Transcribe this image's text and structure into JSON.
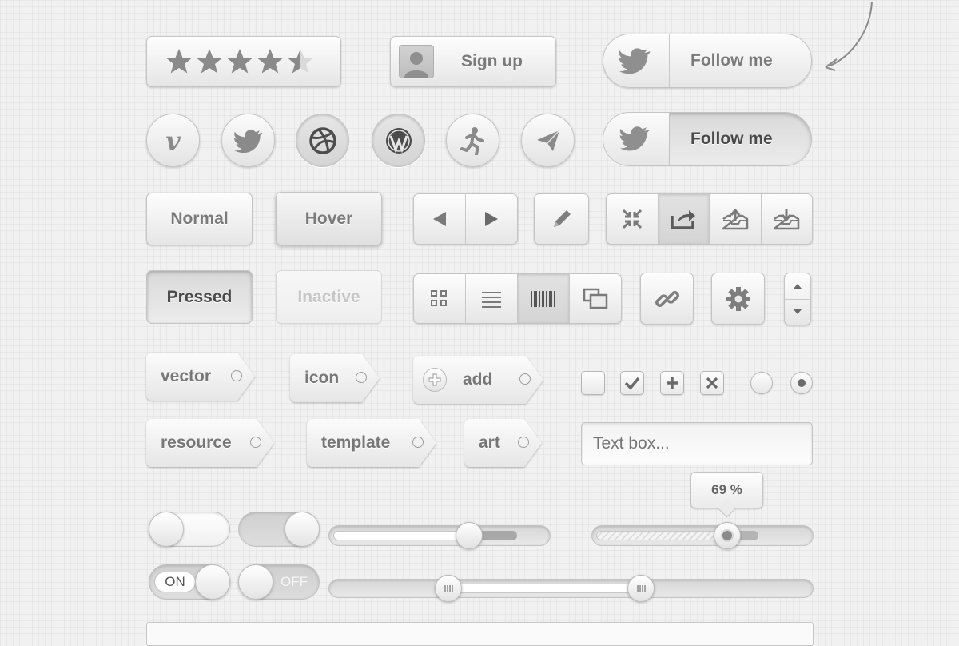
{
  "buttons": {
    "signup_label": "Sign up",
    "follow_label": "Follow me",
    "follow_pressed_label": "Follow me",
    "normal_label": "Normal",
    "hover_label": "Hover",
    "pressed_label": "Pressed",
    "inactive_label": "Inactive"
  },
  "rating": {
    "value": 4.5,
    "max": 5
  },
  "social_icons": [
    "vimeo-icon",
    "twitter-icon",
    "dribbble-icon",
    "wordpress-icon",
    "runner-icon",
    "paper-plane-icon"
  ],
  "tags": {
    "row1": [
      "vector",
      "icon",
      "add"
    ],
    "row2": [
      "resource",
      "template",
      "art"
    ]
  },
  "textbox": {
    "placeholder": "Text box..."
  },
  "toggles": {
    "on_label": "ON",
    "off_label": "OFF"
  },
  "slider": {
    "value_label": "69 %",
    "value": 69
  },
  "colors": {
    "text": "#777777",
    "dark_text": "#4a4a4a",
    "inactive": "#c6c6c6",
    "background": "#f1f1f1"
  }
}
